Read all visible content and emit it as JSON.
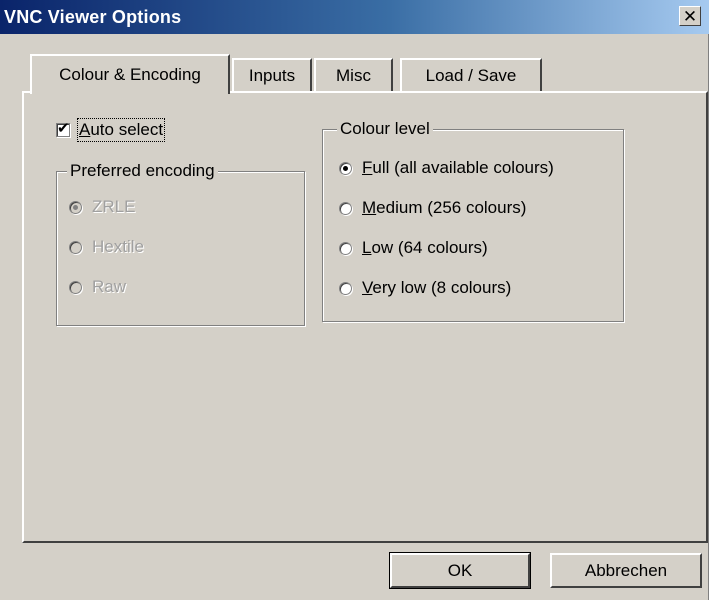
{
  "window": {
    "title": "VNC Viewer Options",
    "close_glyph": "✕"
  },
  "tabs": [
    {
      "label": "Colour & Encoding",
      "active": true
    },
    {
      "label": "Inputs",
      "active": false
    },
    {
      "label": "Misc",
      "active": false
    },
    {
      "label": "Load / Save",
      "active": false
    }
  ],
  "auto_select": {
    "label_first": "A",
    "label_rest": "uto select",
    "checked": true
  },
  "preferred_encoding": {
    "legend": "Preferred encoding",
    "enabled": false,
    "options": [
      {
        "label": "ZRLE",
        "selected": true
      },
      {
        "label": "Hextile",
        "selected": false
      },
      {
        "label": "Raw",
        "selected": false
      }
    ]
  },
  "colour_level": {
    "legend": "Colour level",
    "options": [
      {
        "mnemonic": "F",
        "rest": "ull (all available colours)",
        "selected": true
      },
      {
        "mnemonic": "M",
        "rest": "edium (256 colours)",
        "selected": false
      },
      {
        "mnemonic": "L",
        "rest": "ow (64 colours)",
        "selected": false
      },
      {
        "mnemonic": "V",
        "rest": "ery low (8 colours)",
        "selected": false
      }
    ]
  },
  "buttons": {
    "ok": "OK",
    "cancel": "Abbrechen"
  },
  "icons": {
    "close": "close-icon",
    "check": "checkmark-icon"
  },
  "colors": {
    "titlebar_start": "#0a246a",
    "titlebar_end": "#a6caf0",
    "face": "#d4d0c8"
  }
}
